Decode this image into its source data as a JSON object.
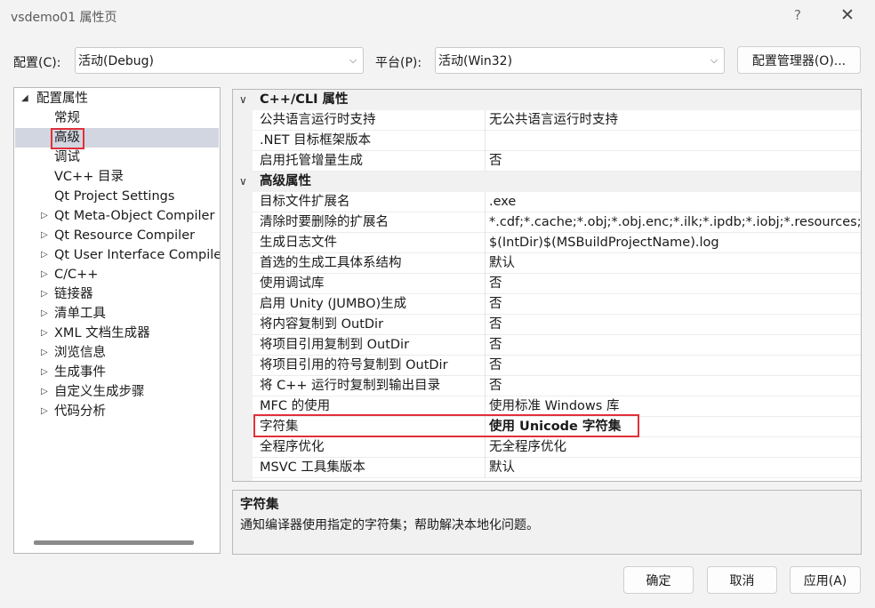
{
  "window": {
    "title": "vsdemo01 属性页",
    "help": "?",
    "close": "✕"
  },
  "config": {
    "label": "配置(C):",
    "value": "活动(Debug)"
  },
  "platform": {
    "label": "平台(P):",
    "value": "活动(Win32)"
  },
  "config_manager_label": "配置管理器(O)...",
  "tree": {
    "root": "配置属性",
    "items": [
      {
        "label": "常规",
        "expandable": false
      },
      {
        "label": "高级",
        "expandable": false,
        "selected": true
      },
      {
        "label": "调试",
        "expandable": false
      },
      {
        "label": "VC++ 目录",
        "expandable": false
      },
      {
        "label": "Qt Project Settings",
        "expandable": false
      },
      {
        "label": "Qt Meta-Object Compiler",
        "expandable": true
      },
      {
        "label": "Qt Resource Compiler",
        "expandable": true
      },
      {
        "label": "Qt User Interface Compiler",
        "expandable": true
      },
      {
        "label": "C/C++",
        "expandable": true
      },
      {
        "label": "链接器",
        "expandable": true
      },
      {
        "label": "清单工具",
        "expandable": true
      },
      {
        "label": "XML 文档生成器",
        "expandable": true
      },
      {
        "label": "浏览信息",
        "expandable": true
      },
      {
        "label": "生成事件",
        "expandable": true
      },
      {
        "label": "自定义生成步骤",
        "expandable": true
      },
      {
        "label": "代码分析",
        "expandable": true
      }
    ]
  },
  "grid": {
    "categories": [
      {
        "title": "C++/CLI 属性",
        "rows": [
          {
            "name": "公共语言运行时支持",
            "value": "无公共语言运行时支持"
          },
          {
            "name": ".NET 目标框架版本",
            "value": ""
          },
          {
            "name": "启用托管增量生成",
            "value": "否"
          }
        ]
      },
      {
        "title": "高级属性",
        "rows": [
          {
            "name": "目标文件扩展名",
            "value": ".exe"
          },
          {
            "name": "清除时要删除的扩展名",
            "value": "*.cdf;*.cache;*.obj;*.obj.enc;*.ilk;*.ipdb;*.iobj;*.resources;*"
          },
          {
            "name": "生成日志文件",
            "value": "$(IntDir)$(MSBuildProjectName).log"
          },
          {
            "name": "首选的生成工具体系结构",
            "value": "默认"
          },
          {
            "name": "使用调试库",
            "value": "否"
          },
          {
            "name": "启用 Unity (JUMBO)生成",
            "value": "否"
          },
          {
            "name": "将内容复制到 OutDir",
            "value": "否"
          },
          {
            "name": "将项目引用复制到 OutDir",
            "value": "否"
          },
          {
            "name": "将项目引用的符号复制到 OutDir",
            "value": "否"
          },
          {
            "name": "将 C++ 运行时复制到输出目录",
            "value": "否"
          },
          {
            "name": "MFC 的使用",
            "value": "使用标准 Windows 库"
          },
          {
            "name": "字符集",
            "value": "使用 Unicode 字符集",
            "bold": true
          },
          {
            "name": "全程序优化",
            "value": "无全程序优化"
          },
          {
            "name": "MSVC 工具集版本",
            "value": "默认"
          }
        ]
      }
    ]
  },
  "description": {
    "title": "字符集",
    "text": "通知编译器使用指定的字符集；帮助解决本地化问题。"
  },
  "buttons": {
    "ok": "确定",
    "cancel": "取消",
    "apply": "应用(A)"
  }
}
